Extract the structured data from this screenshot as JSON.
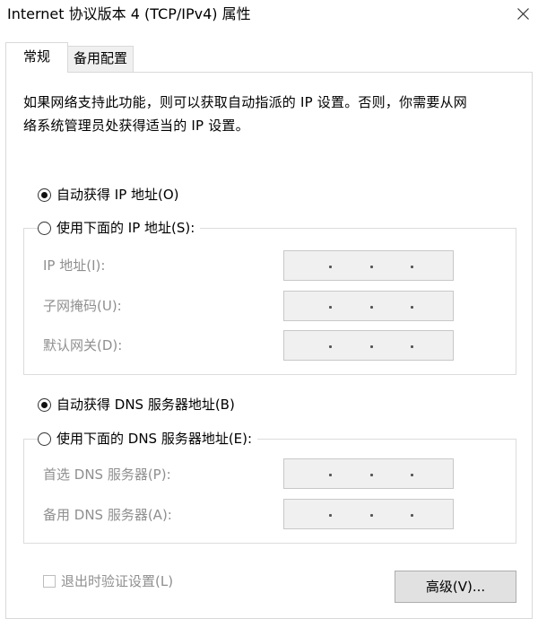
{
  "window": {
    "title": "Internet 协议版本 4 (TCP/IPv4) 属性",
    "close_icon": "close-icon"
  },
  "tabs": [
    {
      "label": "常规",
      "selected": true
    },
    {
      "label": "备用配置",
      "selected": false
    }
  ],
  "description": {
    "line1": "如果网络支持此功能，则可以获取自动指派的 IP 设置。否则，你需要从网",
    "line2": "络系统管理员处获得适当的 IP 设置。"
  },
  "ip": {
    "auto_label": "自动获得 IP 地址(O)",
    "auto_selected": true,
    "manual_label": "使用下面的 IP 地址(S):",
    "manual_selected": false,
    "fields": [
      {
        "label": "IP 地址(I):",
        "value": ". . ."
      },
      {
        "label": "子网掩码(U):",
        "value": ". . ."
      },
      {
        "label": "默认网关(D):",
        "value": ". . ."
      }
    ]
  },
  "dns": {
    "auto_label": "自动获得 DNS 服务器地址(B)",
    "auto_selected": true,
    "manual_label": "使用下面的 DNS 服务器地址(E):",
    "manual_selected": false,
    "fields": [
      {
        "label": "首选 DNS 服务器(P):",
        "value": ". . ."
      },
      {
        "label": "备用 DNS 服务器(A):",
        "value": ". . ."
      }
    ]
  },
  "footer": {
    "validate_label": "退出时验证设置(L)",
    "validate_checked": false,
    "advanced_label": "高级(V)..."
  },
  "colors": {
    "disabled_text": "#8f8f8f",
    "field_background": "#f0f0f0",
    "button_background": "#e1e1e1"
  }
}
